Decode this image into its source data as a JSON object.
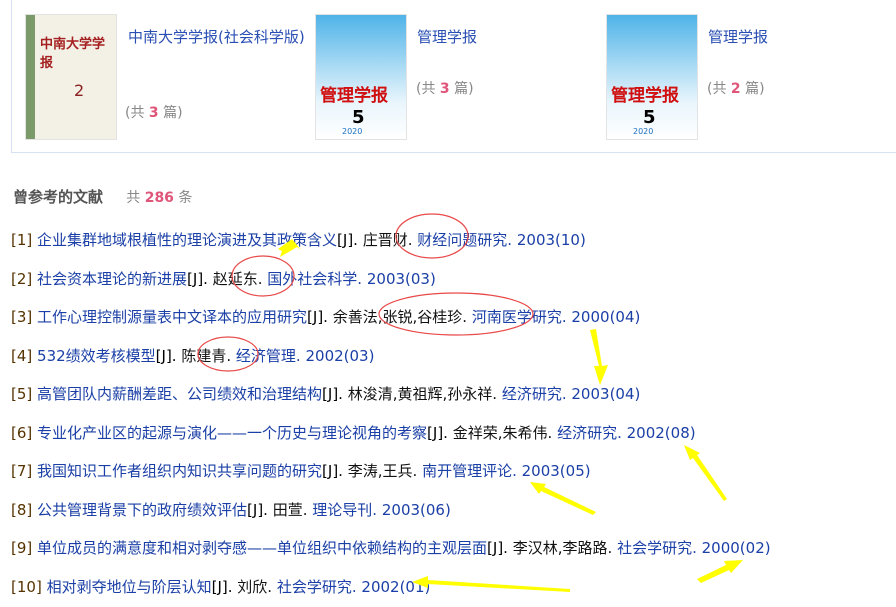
{
  "journals": [
    {
      "name": "中南大学学报(社会科学版)",
      "count_prefix": "(共",
      "count": "3",
      "count_suffix": "篇)",
      "cover_title": "中南大学学报",
      "cover_issue": "2"
    },
    {
      "name": "管理学报",
      "count_prefix": "(共",
      "count": "3",
      "count_suffix": "篇)",
      "cover_title": "管理学报",
      "cover_issue": "5",
      "cover_year": "2020"
    },
    {
      "name": "管理学报",
      "count_prefix": "(共",
      "count": "2",
      "count_suffix": "篇)",
      "cover_title": "管理学报",
      "cover_issue": "5",
      "cover_year": "2020"
    }
  ],
  "section": {
    "title": "曾参考的文献",
    "count_prefix": "共",
    "count": "286",
    "count_suffix": "条"
  },
  "references": [
    {
      "idx": "[1]",
      "title": "企业集群地域根植性的理论演进及其政策含义",
      "type": "[J].",
      "authors": "庄晋财.",
      "journal": "财经问题研究.",
      "year": "2003(10)"
    },
    {
      "idx": "[2]",
      "title": "社会资本理论的新进展",
      "type": "[J].",
      "authors": "赵延东.",
      "journal": "国外社会科学.",
      "year": "2003(03)"
    },
    {
      "idx": "[3]",
      "title": "工作心理控制源量表中文译本的应用研究",
      "type": "[J].",
      "authors": "余善法,张锐,谷桂珍.",
      "journal": "河南医学研究.",
      "year": "2000(04)"
    },
    {
      "idx": "[4]",
      "title": "532绩效考核模型",
      "type": "[J].",
      "authors": "陈建青.",
      "journal": "经济管理.",
      "year": "2002(03)"
    },
    {
      "idx": "[5]",
      "title": "高管团队内薪酬差距、公司绩效和治理结构",
      "type": "[J].",
      "authors": "林浚清,黄祖辉,孙永祥.",
      "journal": "经济研究.",
      "year": "2003(04)"
    },
    {
      "idx": "[6]",
      "title": "专业化产业区的起源与演化——一个历史与理论视角的考察",
      "type": "[J].",
      "authors": "金祥荣,朱希伟.",
      "journal": "经济研究.",
      "year": "2002(08)"
    },
    {
      "idx": "[7]",
      "title": "我国知识工作者组织内知识共享问题的研究",
      "type": "[J].",
      "authors": "李涛,王兵.",
      "journal": "南开管理评论.",
      "year": "2003(05)"
    },
    {
      "idx": "[8]",
      "title": "公共管理背景下的政府绩效评估",
      "type": "[J].",
      "authors": "田萱.",
      "journal": "理论导刊.",
      "year": "2003(06)"
    },
    {
      "idx": "[9]",
      "title": "单位成员的满意度和相对剥夺感——单位组织中依赖结构的主观层面",
      "type": "[J].",
      "authors": "李汉林,李路路.",
      "journal": "社会学研究.",
      "year": "2000(02)"
    },
    {
      "idx": "[10]",
      "title": "相对剥夺地位与阶层认知",
      "type": "[J].",
      "authors": "刘欣.",
      "journal": "社会学研究.",
      "year": "2002(01)"
    }
  ],
  "colors": {
    "link": "#1a3fa6",
    "count": "#e0567a",
    "annotation_circle": "#e03030",
    "annotation_arrow": "#ffff00"
  }
}
